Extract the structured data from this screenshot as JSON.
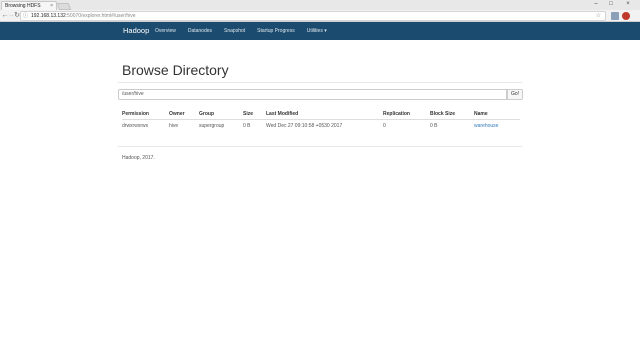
{
  "browser": {
    "tab_title": "Browsing HDFS",
    "tab_close": "×",
    "url_host": "192.168.13.132",
    "url_rest": ":50070/explorer.html#/user/hive",
    "info_icon": "ⓘ",
    "back": "←",
    "forward": "→",
    "reload": "↻",
    "star": "☆",
    "min": "–",
    "max": "□",
    "close": "×"
  },
  "navbar": {
    "brand": "Hadoop",
    "links": [
      "Overview",
      "Datanodes",
      "Snapshot",
      "Startup Progress",
      "Utilities ▾"
    ]
  },
  "page": {
    "title": "Browse Directory",
    "path_value": "/user/hive",
    "go_label": "Go!"
  },
  "table": {
    "headers": [
      "Permission",
      "Owner",
      "Group",
      "Size",
      "Last Modified",
      "Replication",
      "Block Size",
      "Name"
    ],
    "rows": [
      [
        "drwxrwxrwx",
        "hive",
        "supergroup",
        "0 B",
        "Wed Dec 27 09:10:58 +0530 2017",
        "0",
        "0 B",
        "warehouse"
      ]
    ]
  },
  "footer": {
    "text": "Hadoop, 2017."
  },
  "colors": {
    "navbar": "#1b4b6e",
    "link": "#337ab7"
  }
}
